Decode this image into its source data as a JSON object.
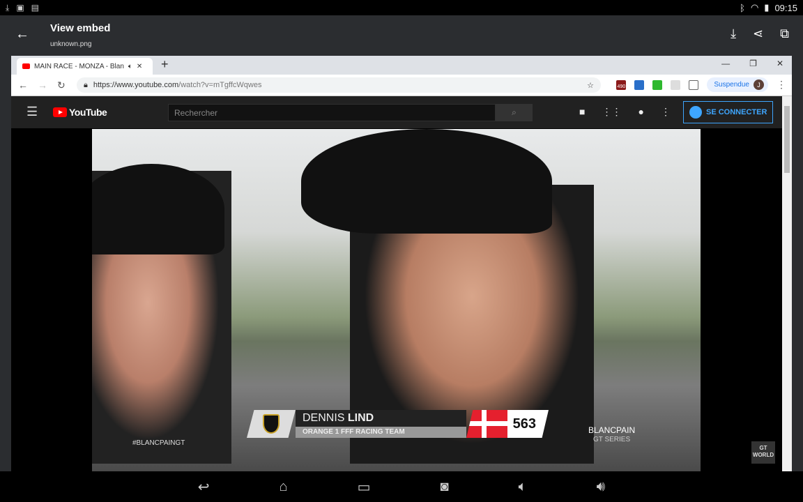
{
  "status_bar": {
    "time": "09:15"
  },
  "app_bar": {
    "title": "View embed",
    "subtitle": "unknown.png"
  },
  "browser": {
    "tab_title": "MAIN RACE - MONZA - Blan",
    "url_host": "https://www.youtube.com",
    "url_path": "/watch?v=mTgffcWqwes",
    "profile_label": "Suspendue",
    "profile_initial": "J",
    "ext_badge": "490"
  },
  "youtube": {
    "logo_text": "YouTube",
    "search_placeholder": "Rechercher",
    "signin_label": "SE CONNECTER"
  },
  "video": {
    "hashtag": "#BLANCPAINGT",
    "driver_first": "DENNIS",
    "driver_last": "LIND",
    "team": "ORANGE 1 FFF RACING TEAM",
    "car_number": "563",
    "sponsor": "BLANCPAIN",
    "sponsor_sub": "GT SERIES",
    "corner_logo": "GT WORLD",
    "flag_colors": {
      "red": "#e5202e",
      "white": "#ffffff"
    }
  },
  "colors": {
    "accent": "#3ea6ff",
    "yt_red": "#ff0000"
  }
}
